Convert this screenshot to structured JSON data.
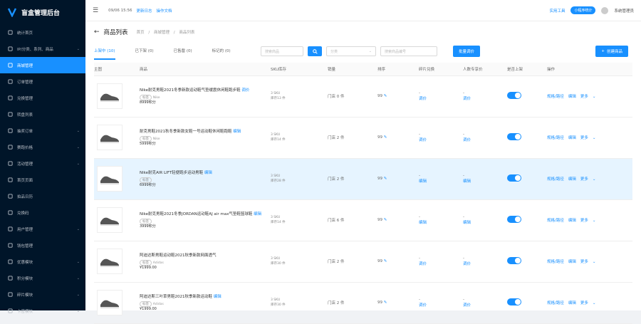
{
  "app": {
    "title": "盲盒管理后台"
  },
  "sidebar": {
    "items": [
      {
        "label": "统计首页",
        "icon": "monitor-icon",
        "active": false,
        "has_sub": false
      },
      {
        "label": "IP/分类、系列、商品",
        "icon": "tag-icon",
        "active": false,
        "has_sub": true
      },
      {
        "label": "商城管理",
        "icon": "shop-icon",
        "active": true,
        "has_sub": false
      },
      {
        "label": "订单管理",
        "icon": "order-icon",
        "active": false,
        "has_sub": false
      },
      {
        "label": "兑换管理",
        "icon": "exchange-icon",
        "active": false,
        "has_sub": false
      },
      {
        "label": "转盘列表",
        "icon": "wheel-icon",
        "active": false,
        "has_sub": false
      },
      {
        "label": "抽奖订单",
        "icon": "ticket-icon",
        "active": false,
        "has_sub": true
      },
      {
        "label": "赛跑价格",
        "icon": "run-icon",
        "active": false,
        "has_sub": true
      },
      {
        "label": "活动管理",
        "icon": "flag-icon",
        "active": false,
        "has_sub": true
      },
      {
        "label": "首页页面",
        "icon": "home-icon",
        "active": false,
        "has_sub": false
      },
      {
        "label": "拍品日历",
        "icon": "calendar-icon",
        "active": false,
        "has_sub": false
      },
      {
        "label": "兑换码",
        "icon": "code-icon",
        "active": false,
        "has_sub": false
      },
      {
        "label": "用户管理",
        "icon": "user-icon",
        "active": false,
        "has_sub": true
      },
      {
        "label": "钱包管理",
        "icon": "wallet-icon",
        "active": false,
        "has_sub": false
      },
      {
        "label": "优惠模块",
        "icon": "coupon-icon",
        "active": false,
        "has_sub": true
      },
      {
        "label": "积分模块",
        "icon": "points-icon",
        "active": false,
        "has_sub": true
      },
      {
        "label": "碎片模块",
        "icon": "piece-icon",
        "active": false,
        "has_sub": true
      },
      {
        "label": "卡密模块",
        "icon": "card-icon",
        "active": false,
        "has_sub": true
      }
    ]
  },
  "topbar": {
    "timestamp": "09/06 15:56",
    "update_log": "更新日志",
    "docs": "操作文档",
    "tools": "实用工具",
    "mini_stats": "小程序统计",
    "user": "系统管理员"
  },
  "page": {
    "title": "商品列表",
    "breadcrumb": [
      "首页",
      "/",
      "商城管理",
      "/",
      "商品列表"
    ],
    "tabs": [
      {
        "label": "上架中 (10)",
        "active": true
      },
      {
        "label": "已下架 (0)",
        "active": false
      },
      {
        "label": "已售罄 (0)",
        "active": false
      },
      {
        "label": "标记的 (0)",
        "active": false
      }
    ],
    "search_placeholder": "搜索商品",
    "category_placeholder": "分类",
    "code_placeholder": "搜索商品编号",
    "batch_label": "批量调价",
    "create_label": "创建商品"
  },
  "table": {
    "headers": [
      "主图",
      "商品",
      "SKU库存",
      "销量",
      "排序",
      "碎片兑换",
      "人数专享价",
      "是否上架",
      "操作"
    ],
    "rows": [
      {
        "name": "Nike耐克男鞋2021冬季新款运动鞋气垫缓震休闲鞋跑步鞋",
        "edit": "调价",
        "tag": "标签",
        "brand": "Nike",
        "price": "8999积分",
        "sku": "3 SKU",
        "stock": "库存13 件",
        "sales": "门店 0 件",
        "sort": "99",
        "frag": "-",
        "frag_link": "调价",
        "group": "-",
        "group_link": "调价",
        "ops": [
          "规格/路径",
          "编辑",
          "更多"
        ],
        "highlight": false
      },
      {
        "name": "耐克男鞋2021秋冬季新款女鞋一号运动鞋休闲鞋跑鞋",
        "edit": "编辑",
        "tag": "标签",
        "brand": "Nike",
        "price": "5999积分",
        "sku": "3 SKU",
        "stock": "库存14 件",
        "sales": "门店 2 件",
        "sort": "99",
        "frag": "-",
        "frag_link": "调价",
        "group": "-",
        "group_link": "调价",
        "ops": [
          "规格/路径",
          "编辑",
          "更多"
        ],
        "highlight": false
      },
      {
        "name": "Nike耐克AIR LIFT轻便跑步运动男鞋",
        "edit": "编辑",
        "tag": "标签",
        "brand": "",
        "price": "6999积分",
        "sku": "3 SKU",
        "stock": "库存28 件",
        "sales": "门店 2 件",
        "sort": "99",
        "frag": "-",
        "frag_link": "编辑",
        "group": "-",
        "group_link": "编辑",
        "ops": [
          "规格/路径",
          "编辑",
          "更多"
        ],
        "highlight": true
      },
      {
        "name": "Nike耐克男鞋2021冬季JORDAN运动鞋AJ air max气垫鞋篮球鞋",
        "edit": "编辑",
        "tag": "标签",
        "brand": "",
        "price": "3999积分",
        "sku": "3 SKU",
        "stock": "库存14 件",
        "sales": "门店 6 件",
        "sort": "99",
        "frag": "-",
        "frag_link": "编辑",
        "group": "-",
        "group_link": "编辑",
        "ops": [
          "规格/路径",
          "编辑",
          "更多"
        ],
        "highlight": false
      },
      {
        "name": "阿迪达斯男鞋运动鞋2021秋季新款网面透气",
        "edit": "",
        "tag": "标签",
        "brand": "Adidas",
        "price": "¥1999.00",
        "sku": "3 SKU",
        "stock": "库存30 件",
        "sales": "门店 2 件",
        "sort": "99",
        "frag": "-",
        "frag_link": "调价",
        "group": "-",
        "group_link": "调价",
        "ops": [
          "规格/路径",
          "编辑",
          "更多"
        ],
        "highlight": false
      },
      {
        "name": "阿迪达斯三叶草男鞋2021秋季新款运动鞋",
        "edit": "编辑",
        "tag": "标签",
        "brand": "Adidas",
        "price": "¥1999.00",
        "sku": "3 SKU",
        "stock": "库存30 件",
        "sales": "门店 2 件",
        "sort": "99",
        "frag": "-",
        "frag_link": "调价",
        "group": "-",
        "group_link": "调价",
        "ops": [
          "规格/路径",
          "编辑",
          "更多"
        ],
        "highlight": false
      }
    ]
  },
  "colors": {
    "primary": "#1890ff",
    "sidebar": "#001529",
    "highlight_row": "#e6f4ff"
  }
}
